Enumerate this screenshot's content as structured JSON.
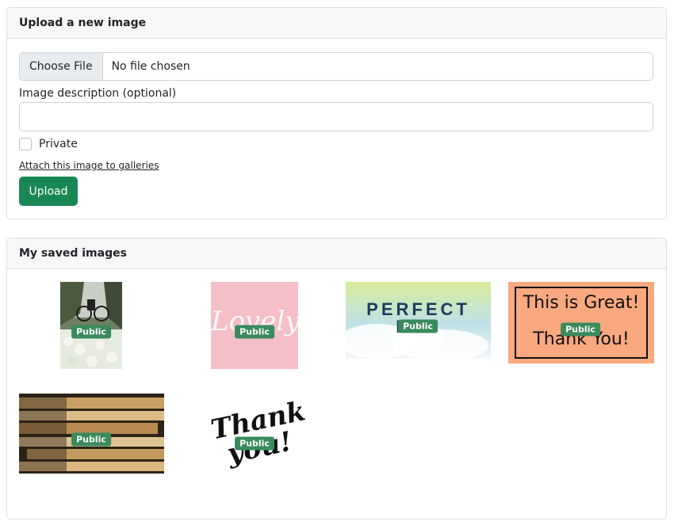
{
  "upload_card": {
    "title": "Upload a new image",
    "file_button_label": "Choose File",
    "file_status": "No file chosen",
    "description_label": "Image description (optional)",
    "description_value": "",
    "private_label": "Private",
    "private_checked": false,
    "attach_link": "Attach this image to galleries",
    "upload_button": "Upload"
  },
  "saved_card": {
    "title": "My saved images",
    "images": [
      {
        "badge": "Public",
        "alt_text_shown": ""
      },
      {
        "badge": "Public",
        "image_text": "Lovely"
      },
      {
        "badge": "Public",
        "image_text": "PERFECT DAY"
      },
      {
        "badge": "Public",
        "image_text_line1": "This is Great!",
        "image_text_line2": "Thank You!"
      },
      {
        "badge": "Public"
      },
      {
        "badge": "Public",
        "image_text": "Thank you!"
      }
    ]
  },
  "colors": {
    "primary_button": "#198754",
    "badge": "#3a8a5c",
    "header_bg": "#f7f7f7"
  }
}
